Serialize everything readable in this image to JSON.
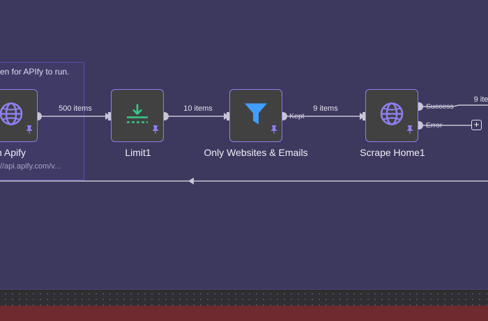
{
  "sticky_note": {
    "text": "en for APIfy to run."
  },
  "nodes": [
    {
      "label": "n Apify",
      "sublabel": "//api.apify.com/v...",
      "icon": "globe-icon"
    },
    {
      "label": "Limit1",
      "icon": "limit-download-icon"
    },
    {
      "label": "Only Websites & Emails",
      "icon": "filter-icon"
    },
    {
      "label": "Scrape Home1",
      "icon": "globe-icon"
    }
  ],
  "connections": [
    {
      "label": "500 items"
    },
    {
      "label": "10 items"
    },
    {
      "label": "9 items"
    },
    {
      "label": "9 ite"
    }
  ],
  "outputs": {
    "kept": "Kept",
    "success": "Success",
    "error": "Error"
  },
  "add_button": "+",
  "colors": {
    "accent": "#8d7ff0",
    "limit": "#35c98a",
    "filter": "#3f9eff",
    "background": "#3d385d"
  }
}
